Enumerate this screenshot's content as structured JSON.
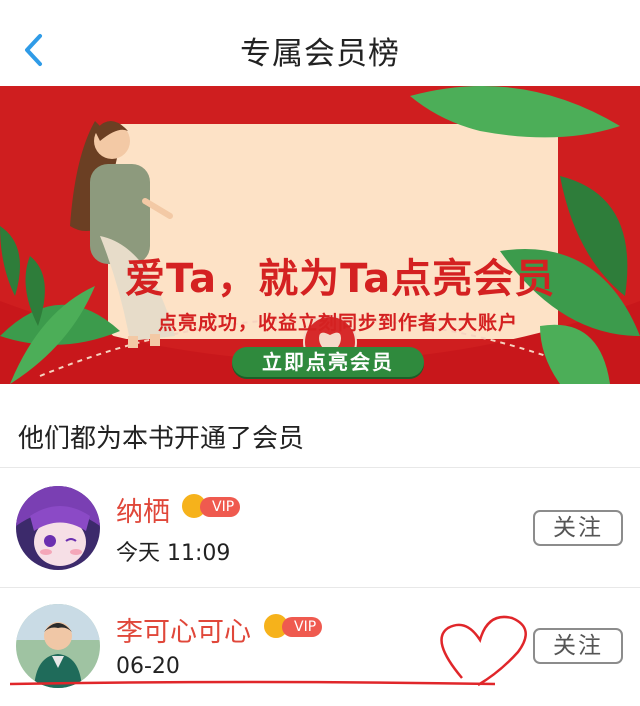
{
  "header": {
    "title": "专属会员榜"
  },
  "banner": {
    "headline": "爱Ta，就为Ta点亮会员",
    "subtitle": "点亮成功，收益立刻同步到作者大大账户",
    "button_label": "立即点亮会员"
  },
  "section_title": "他们都为本书开通了会员",
  "members": [
    {
      "name": "纳栖",
      "vip_label": "VIP",
      "time": "今天 11:09",
      "follow_label": "关注"
    },
    {
      "name": "李可心可心",
      "vip_label": "VIP",
      "time": "06-20",
      "follow_label": "关注"
    }
  ],
  "colors": {
    "accent": "#2f9be7",
    "banner_bg": "#cf1e1f",
    "name": "#e0473a",
    "button_green": "#2f8a3d"
  }
}
